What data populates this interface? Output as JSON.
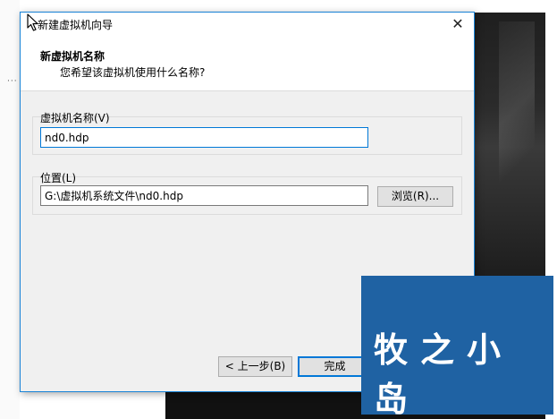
{
  "window": {
    "title": "新建虚拟机向导",
    "close_glyph": "✕"
  },
  "header": {
    "title": "新虚拟机名称",
    "subtitle": "您希望该虚拟机使用什么名称?"
  },
  "name_field": {
    "label": "虚拟机名称(V)",
    "value": "nd0.hdp"
  },
  "location_field": {
    "label": "位置(L)",
    "value": "G:\\虚拟机系统文件\\nd0.hdp",
    "browse_label": "浏览(R)..."
  },
  "footer": {
    "back_label": "< 上一步(B)",
    "finish_label": "完成"
  },
  "watermark": {
    "text": "牧之小岛",
    "color": "#1f62a3"
  }
}
